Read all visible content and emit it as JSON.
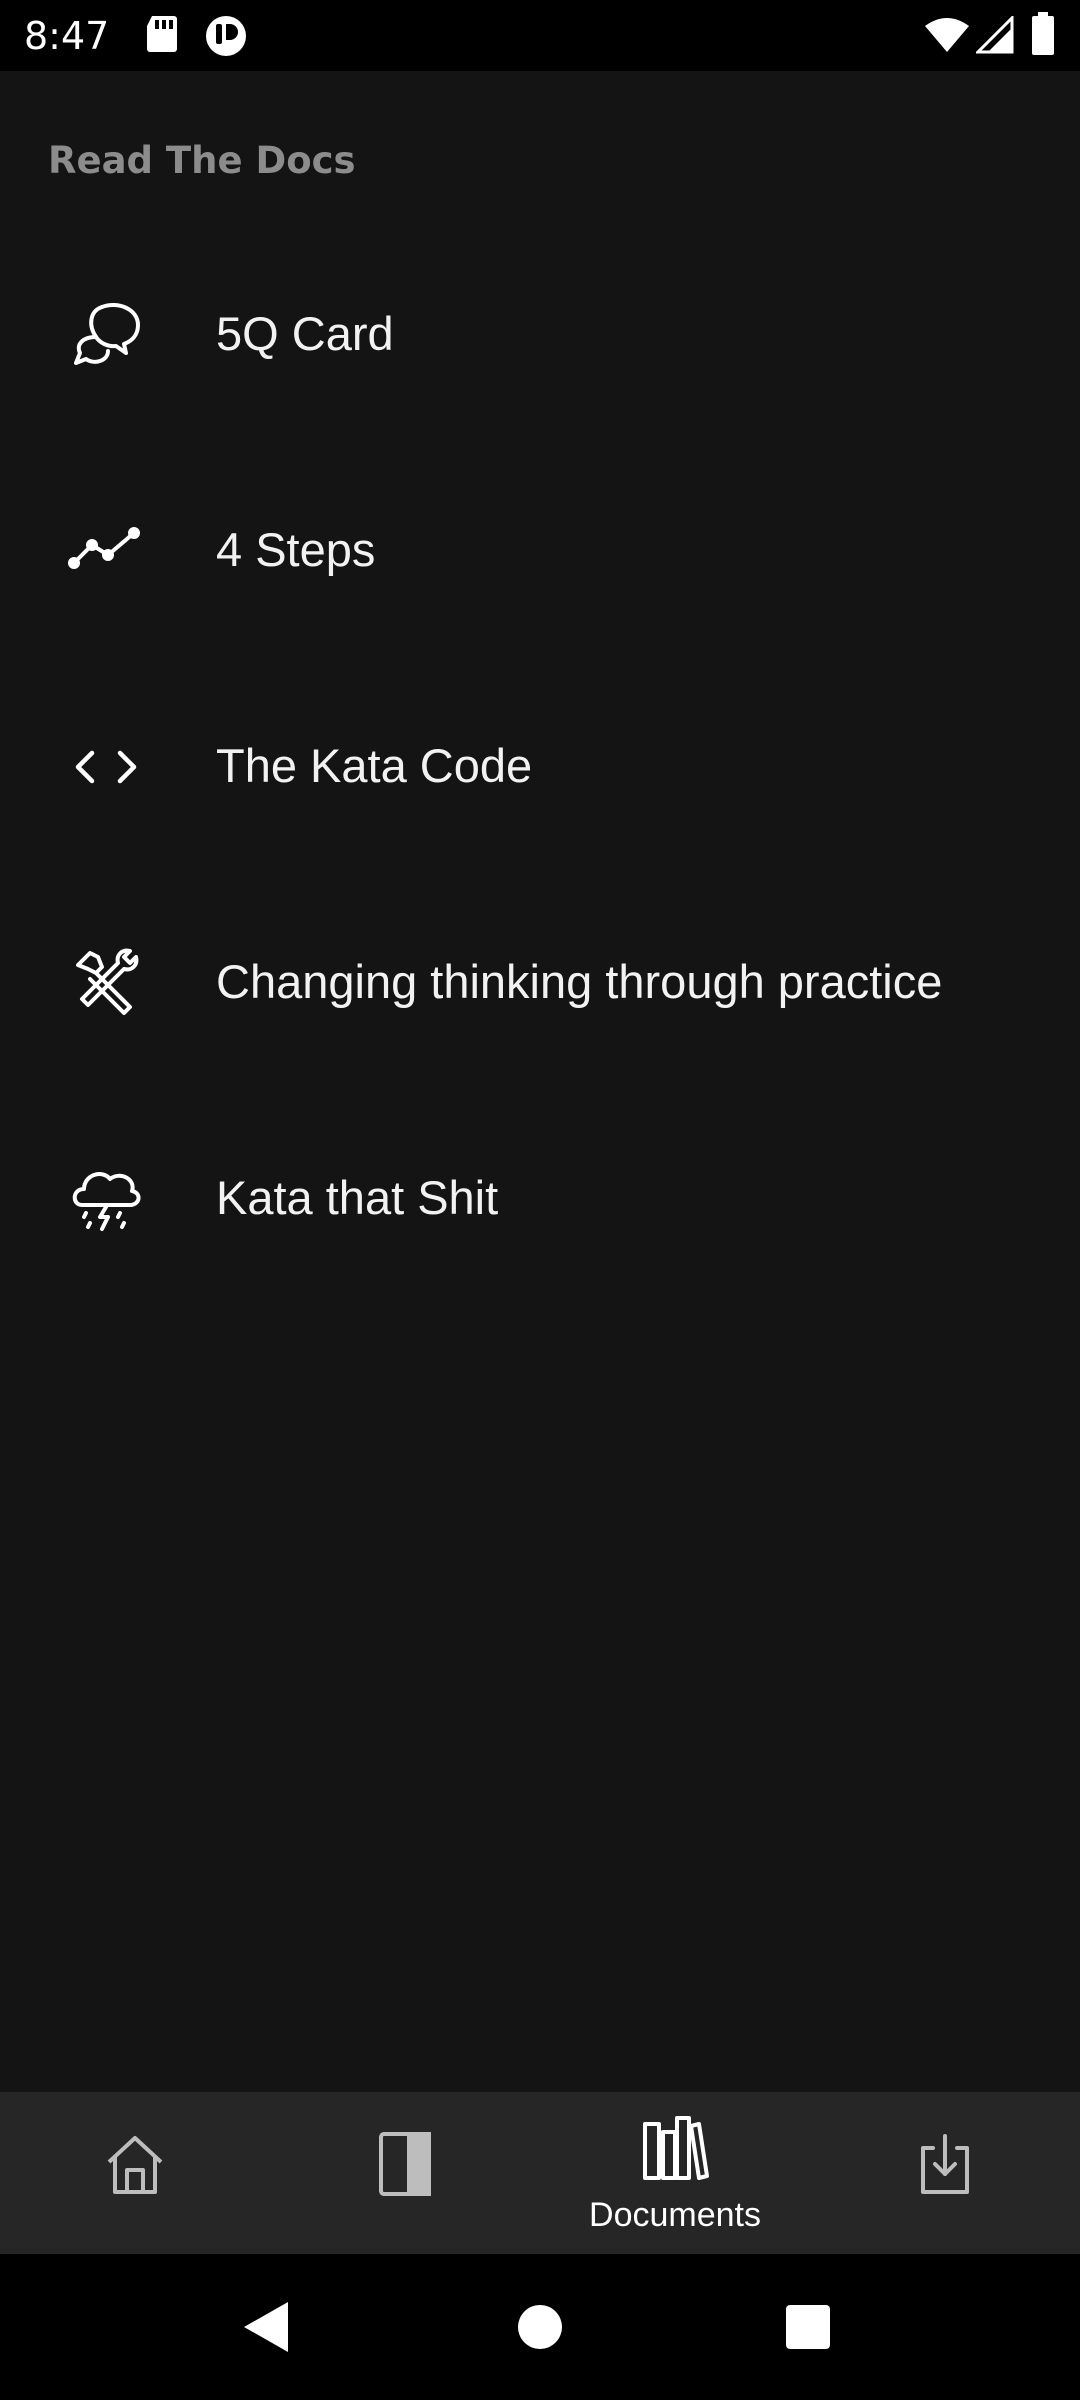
{
  "status_bar": {
    "time": "8:47",
    "icons": [
      "sd-card-icon",
      "app-notification-icon",
      "wifi-icon",
      "cellular-signal-icon",
      "battery-icon"
    ]
  },
  "section": {
    "title": "Read The Docs"
  },
  "documents": [
    {
      "label": "5Q Card",
      "icon": "chat-bubbles-icon"
    },
    {
      "label": "4 Steps",
      "icon": "line-chart-icon"
    },
    {
      "label": "The Kata Code",
      "icon": "code-brackets-icon"
    },
    {
      "label": "Changing thinking through practice",
      "icon": "tools-icon"
    },
    {
      "label": "Kata that Shit",
      "icon": "storm-cloud-icon"
    }
  ],
  "bottom_nav": {
    "items": [
      {
        "icon": "home-icon",
        "label": "",
        "active": false
      },
      {
        "icon": "panel-icon",
        "label": "",
        "active": false
      },
      {
        "icon": "library-icon",
        "label": "Documents",
        "active": true
      },
      {
        "icon": "download-icon",
        "label": "",
        "active": false
      }
    ]
  },
  "system_nav": {
    "buttons": [
      "back-icon",
      "home-circle-icon",
      "recents-square-icon"
    ]
  },
  "colors": {
    "background": "#141414",
    "status_bar": "#000000",
    "bottom_nav": "#262626",
    "section_title": "#8c8c8c",
    "text": "#f2f2f2"
  }
}
